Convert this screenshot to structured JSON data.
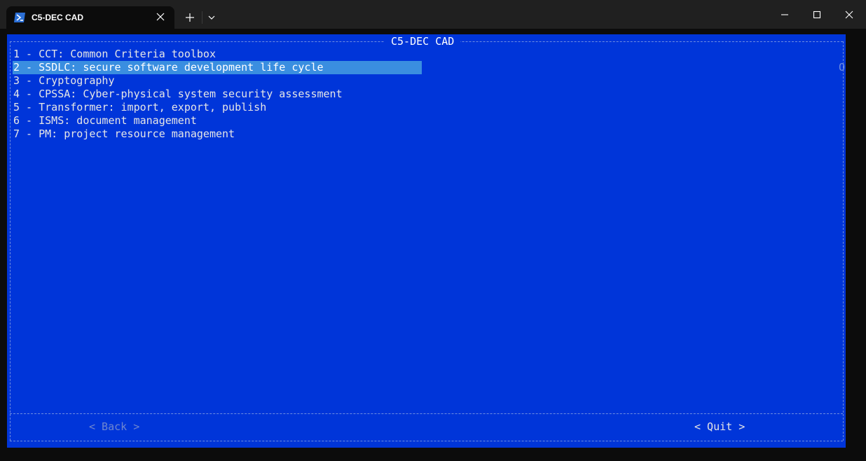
{
  "window": {
    "tab_title": "C5-DEC CAD",
    "tab_icon": "powershell-icon"
  },
  "dialog": {
    "title": "C5-DEC CAD",
    "items": [
      {
        "label": "1 - CCT: Common Criteria toolbox",
        "selected": false
      },
      {
        "label": "2 - SSDLC: secure software development life cycle",
        "selected": true
      },
      {
        "label": "3 - Cryptography",
        "selected": false
      },
      {
        "label": "4 - CPSSA: Cyber-physical system security assessment",
        "selected": false
      },
      {
        "label": "5 - Transformer: import, export, publish",
        "selected": false
      },
      {
        "label": "6 - ISMS: document management",
        "selected": false
      },
      {
        "label": "7 - PM: project resource management",
        "selected": false
      }
    ],
    "scroll_indicator": "O",
    "back_label": "< Back >",
    "quit_label": "< Quit >"
  },
  "colors": {
    "terminal_bg": "#0035d9",
    "selection_bg": "#3a8ee0",
    "border": "#6f8de0"
  }
}
